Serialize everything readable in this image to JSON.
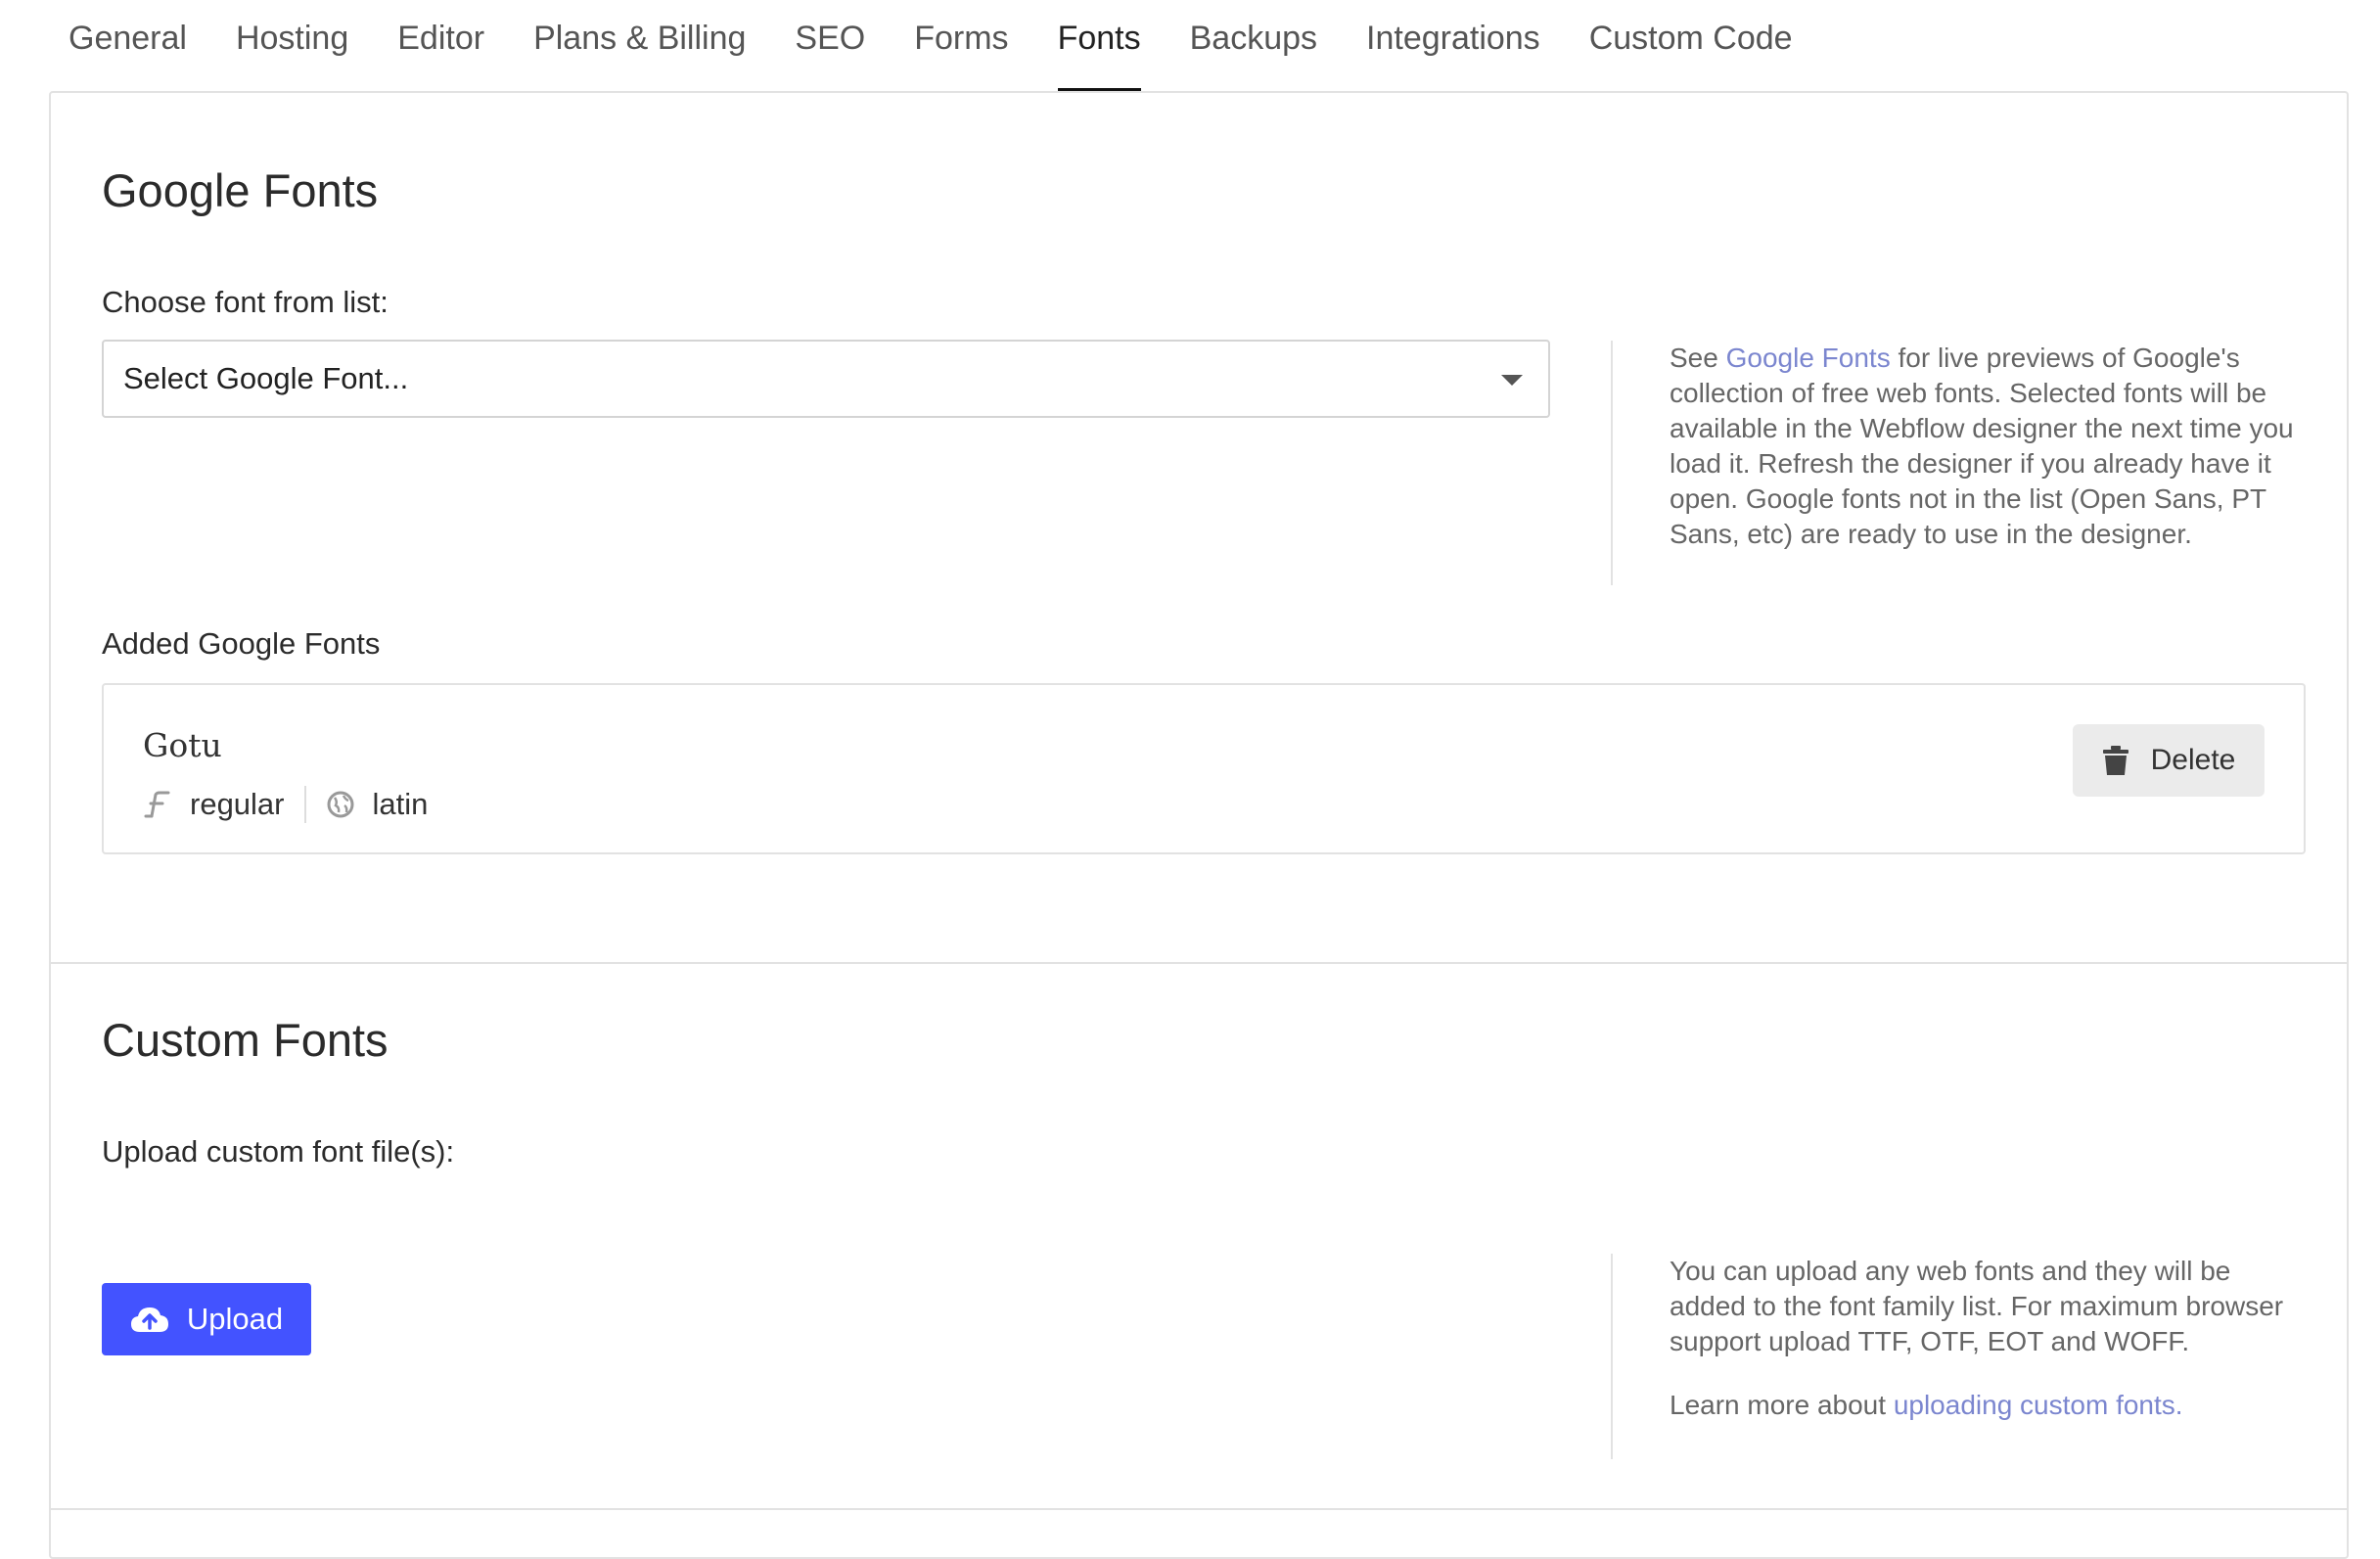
{
  "tabs": [
    {
      "label": "General"
    },
    {
      "label": "Hosting"
    },
    {
      "label": "Editor"
    },
    {
      "label": "Plans & Billing"
    },
    {
      "label": "SEO"
    },
    {
      "label": "Forms"
    },
    {
      "label": "Fonts",
      "active": true
    },
    {
      "label": "Backups"
    },
    {
      "label": "Integrations"
    },
    {
      "label": "Custom Code"
    }
  ],
  "google_fonts": {
    "title": "Google Fonts",
    "choose_label": "Choose font from list:",
    "select_value": "Select Google Font...",
    "help_prefix": "See ",
    "help_link": "Google Fonts",
    "help_suffix": " for live previews of Google's collection of free web fonts. Selected fonts will be available in the Webflow designer the next time you load it. Refresh the designer if you already have it open. Google fonts not in the list (Open Sans, PT Sans, etc) are ready to use in the designer.",
    "added_label": "Added Google Fonts",
    "added": [
      {
        "name": "Gotu",
        "weight": "regular",
        "subset": "latin",
        "delete_label": "Delete"
      }
    ]
  },
  "custom_fonts": {
    "title": "Custom Fonts",
    "upload_label": "Upload custom font file(s):",
    "upload_button": "Upload",
    "help_text": "You can upload any web fonts and they will be added to the font family list. For maximum browser support upload TTF, OTF, EOT and WOFF.",
    "learn_prefix": "Learn more about ",
    "learn_link": "uploading custom fonts."
  },
  "colors": {
    "accent": "#4353ff",
    "link": "#7b86cf",
    "border": "#e2e2e2"
  }
}
